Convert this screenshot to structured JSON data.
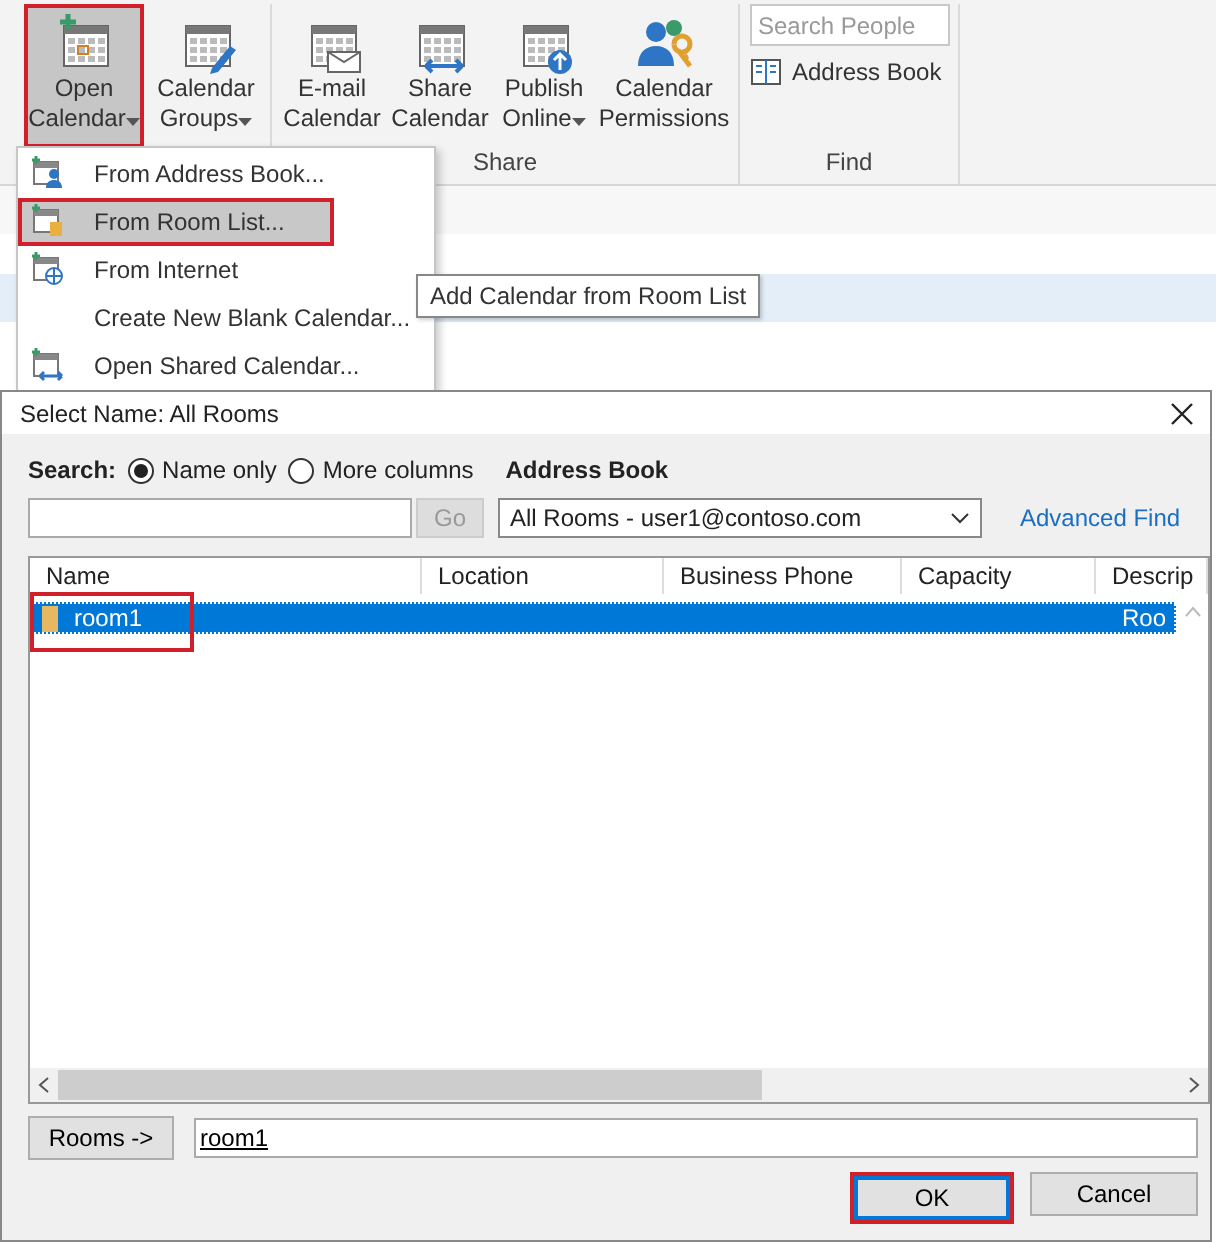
{
  "ribbon": {
    "buttons": [
      {
        "label": "Open",
        "label2": "Calendar",
        "dropdown": true,
        "selected": true,
        "annotated": true
      },
      {
        "label": "Calendar",
        "label2": "Groups",
        "dropdown": true,
        "selected": false,
        "annotated": false
      },
      {
        "label": "E-mail",
        "label2": "Calendar",
        "dropdown": false,
        "selected": false,
        "annotated": false
      },
      {
        "label": "Share",
        "label2": "Calendar",
        "dropdown": false,
        "selected": false,
        "annotated": false
      },
      {
        "label": "Publish",
        "label2": "Online",
        "dropdown": true,
        "selected": false,
        "annotated": false
      },
      {
        "label": "Calendar",
        "label2": "Permissions",
        "dropdown": false,
        "selected": false,
        "annotated": false
      }
    ],
    "share_group_label": "Share",
    "find": {
      "search": {
        "placeholder": "Search People"
      },
      "address_book": "Address Book",
      "group_label": "Find"
    }
  },
  "menu": {
    "items": [
      {
        "label": "From Address Book...",
        "selected": false,
        "annotated": false
      },
      {
        "label": "From Room List...",
        "selected": true,
        "annotated": true
      },
      {
        "label": "From Internet",
        "selected": false,
        "annotated": false
      },
      {
        "label": "Create New Blank Calendar...",
        "selected": false,
        "annotated": false
      },
      {
        "label": "Open Shared Calendar...",
        "selected": false,
        "annotated": false
      }
    ]
  },
  "tooltip": "Add Calendar from Room List",
  "dialog": {
    "title": "Select Name: All Rooms",
    "search_label": "Search:",
    "search_options": [
      {
        "label": "Name only",
        "selected": true
      },
      {
        "label": "More columns",
        "selected": false
      }
    ],
    "address_book_label": "Address Book",
    "go_button": {
      "label": "Go",
      "disabled": true
    },
    "address_book_value": "All Rooms - user1@contoso.com",
    "advanced_find": "Advanced Find",
    "table": {
      "columns": [
        "Name",
        "Location",
        "Business Phone",
        "Capacity",
        "Descrip"
      ],
      "rows": [
        {
          "cells": [
            "room1",
            "",
            "",
            "",
            "Roo"
          ],
          "selected": true,
          "annotated": true
        }
      ]
    },
    "rooms_button": "Rooms ->",
    "rooms_value": "room1",
    "buttons": [
      {
        "label": "OK",
        "annotated": true
      },
      {
        "label": "Cancel",
        "annotated": false
      }
    ]
  }
}
